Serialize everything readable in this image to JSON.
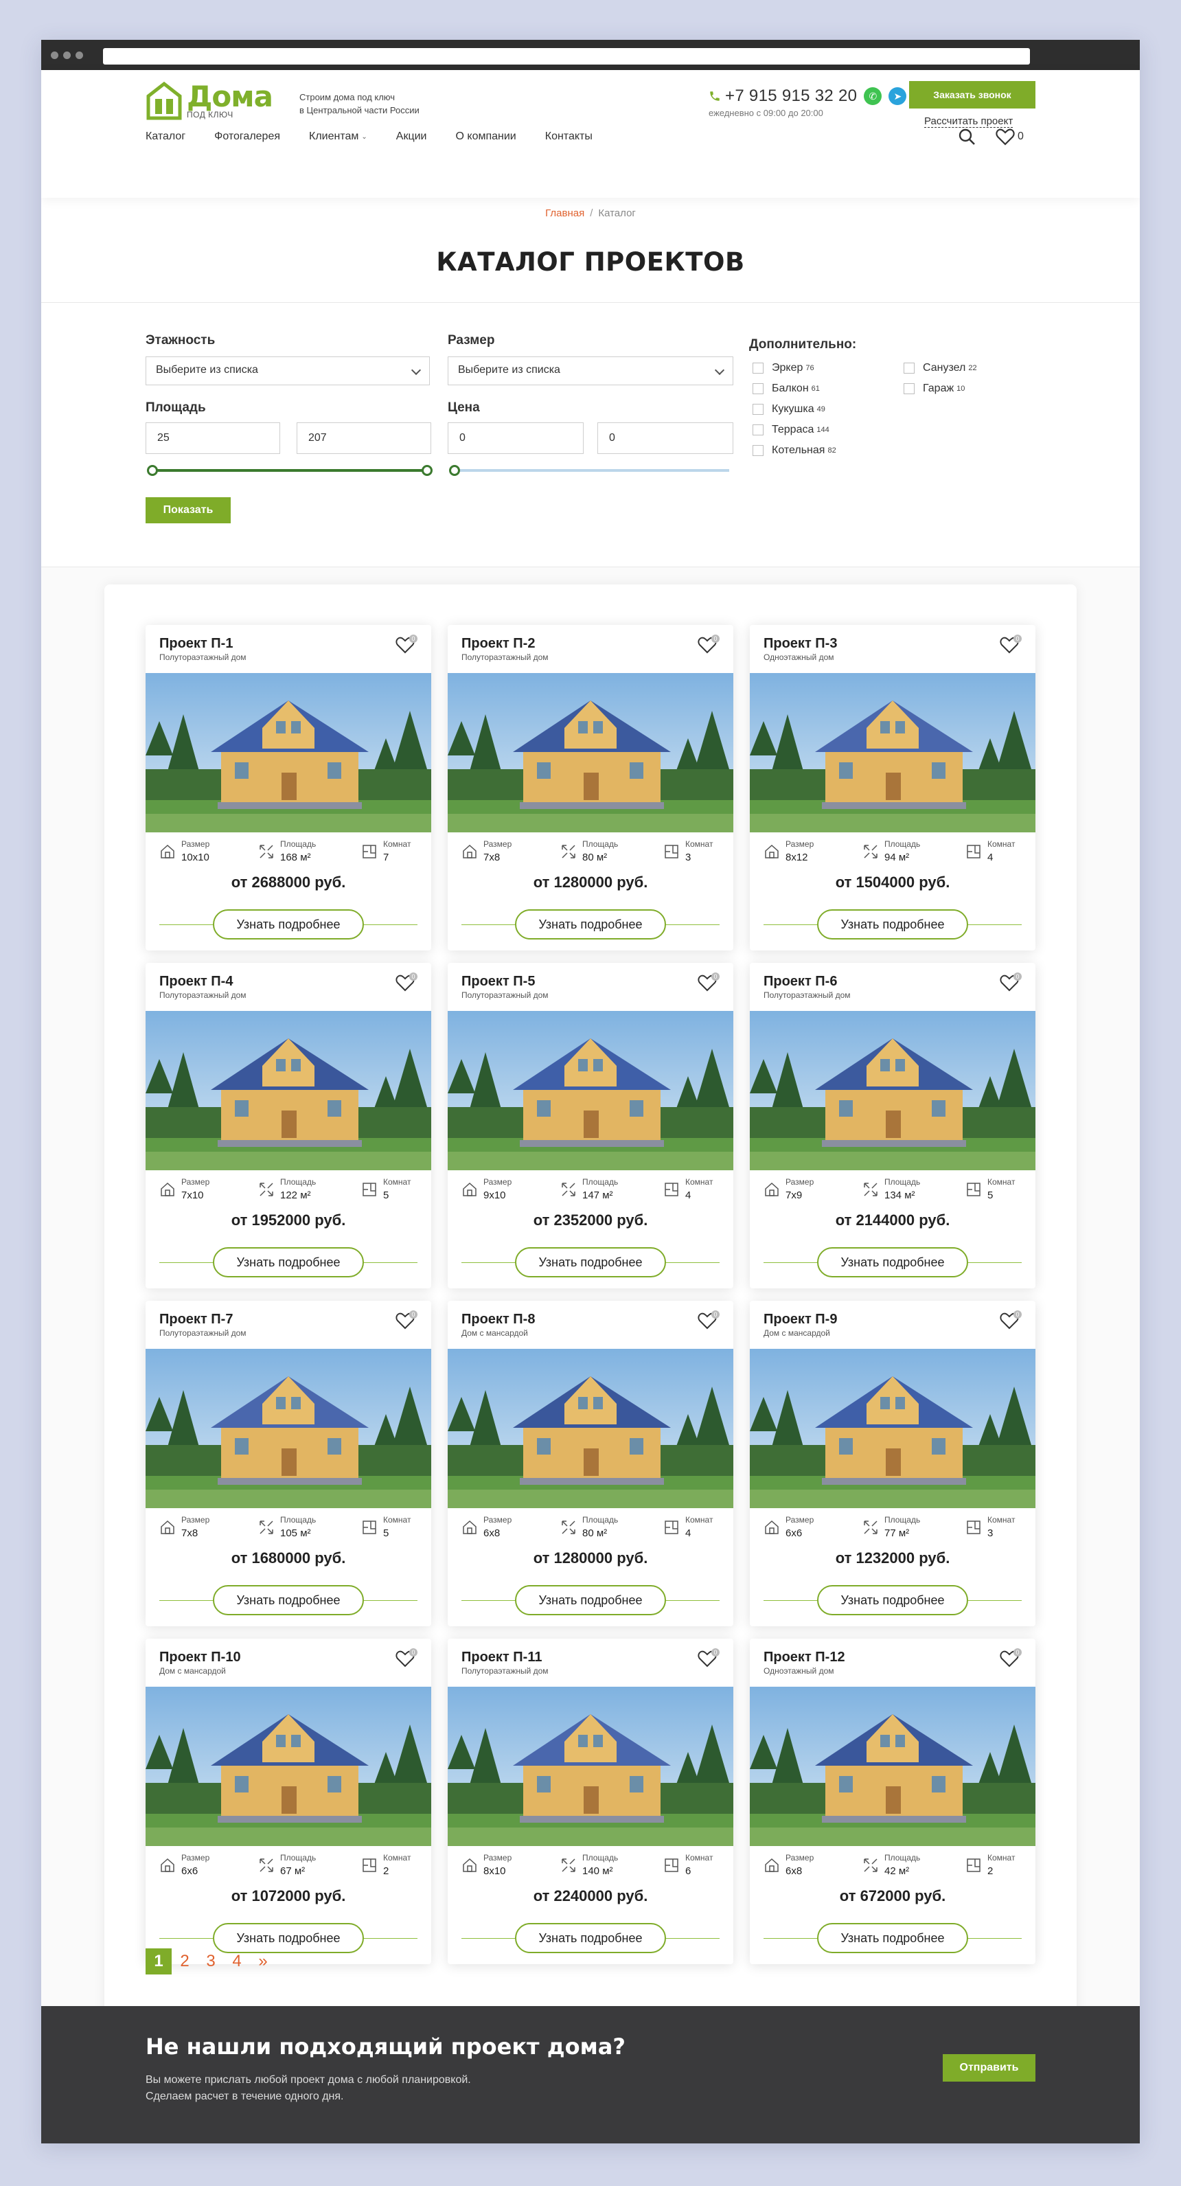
{
  "header": {
    "logo_name": "Дома",
    "logo_sub": "ПОД КЛЮЧ",
    "tagline_line1": "Строим дома под ключ",
    "tagline_line2": "в Центральной части России",
    "phone": "+7 915 915 32 20",
    "hours": "ежедневно с 09:00 до 20:00",
    "call_button": "Заказать звонок",
    "calc_link": "Рассчитать проект",
    "fav_count": "0",
    "nav": [
      {
        "label": "Каталог"
      },
      {
        "label": "Фотогалерея"
      },
      {
        "label": "Клиентам"
      },
      {
        "label": "Акции"
      },
      {
        "label": "О компании"
      },
      {
        "label": "Контакты"
      }
    ]
  },
  "breadcrumb": {
    "home": "Главная",
    "separator": "/",
    "current": "Каталог"
  },
  "page_title": "КАТАЛОГ ПРОЕКТОВ",
  "filter": {
    "floors_label": "Этажность",
    "floors_value": "Выберите из списка",
    "size_label": "Размер",
    "size_value": "Выберите из списка",
    "area_label": "Площадь",
    "area_min": "25",
    "area_max": "207",
    "price_label": "Цена",
    "price_min": "0",
    "price_max": "0",
    "area_slider_fraction": [
      0,
      1
    ],
    "price_slider_fraction": [
      0,
      0
    ],
    "extra_label": "Дополнительно:",
    "options": [
      {
        "label": "Эркер",
        "count": "76"
      },
      {
        "label": "Балкон",
        "count": "61"
      },
      {
        "label": "Кукушка",
        "count": "49"
      },
      {
        "label": "Терраса",
        "count": "144"
      },
      {
        "label": "Котельная",
        "count": "82"
      },
      {
        "label": "Санузел",
        "count": "22"
      },
      {
        "label": "Гараж",
        "count": "10"
      }
    ],
    "show_button": "Показать"
  },
  "card_labels": {
    "size": "Размер",
    "area": "Площадь",
    "rooms": "Комнат",
    "more": "Узнать подробнее",
    "fav_count": "0"
  },
  "projects": [
    {
      "title": "Проект П-1",
      "type": "Полутораэтажный дом",
      "size": "10х10",
      "area": "168 м²",
      "rooms": "7",
      "price": "от 2688000 руб."
    },
    {
      "title": "Проект П-2",
      "type": "Полутораэтажный дом",
      "size": "7х8",
      "area": "80 м²",
      "rooms": "3",
      "price": "от 1280000 руб."
    },
    {
      "title": "Проект П-3",
      "type": "Одноэтажный дом",
      "size": "8х12",
      "area": "94 м²",
      "rooms": "4",
      "price": "от 1504000 руб."
    },
    {
      "title": "Проект П-4",
      "type": "Полутораэтажный дом",
      "size": "7х10",
      "area": "122 м²",
      "rooms": "5",
      "price": "от 1952000 руб."
    },
    {
      "title": "Проект П-5",
      "type": "Полутораэтажный дом",
      "size": "9х10",
      "area": "147 м²",
      "rooms": "4",
      "price": "от 2352000 руб."
    },
    {
      "title": "Проект П-6",
      "type": "Полутораэтажный дом",
      "size": "7х9",
      "area": "134 м²",
      "rooms": "5",
      "price": "от 2144000 руб."
    },
    {
      "title": "Проект П-7",
      "type": "Полутораэтажный дом",
      "size": "7х8",
      "area": "105 м²",
      "rooms": "5",
      "price": "от 1680000 руб."
    },
    {
      "title": "Проект П-8",
      "type": "Дом с мансардой",
      "size": "6х8",
      "area": "80 м²",
      "rooms": "4",
      "price": "от 1280000 руб."
    },
    {
      "title": "Проект П-9",
      "type": "Дом с мансардой",
      "size": "6х6",
      "area": "77 м²",
      "rooms": "3",
      "price": "от 1232000 руб."
    },
    {
      "title": "Проект П-10",
      "type": "Дом с мансардой",
      "size": "6х6",
      "area": "67 м²",
      "rooms": "2",
      "price": "от 1072000 руб."
    },
    {
      "title": "Проект П-11",
      "type": "Полутораэтажный дом",
      "size": "8х10",
      "area": "140 м²",
      "rooms": "6",
      "price": "от 2240000 руб."
    },
    {
      "title": "Проект П-12",
      "type": "Одноэтажный дом",
      "size": "6х8",
      "area": "42 м²",
      "rooms": "2",
      "price": "от 672000 руб."
    }
  ],
  "pagination": {
    "pages": [
      "1",
      "2",
      "3",
      "4"
    ],
    "next": "»",
    "active": "1"
  },
  "cta": {
    "title": "Не нашли подходящий проект дома?",
    "text_line1": "Вы можете прислать любой проект дома с любой планировкой.",
    "text_line2": "Сделаем расчет в течение одного дня.",
    "button": "Отправить"
  },
  "colors": {
    "accent": "#7fac29",
    "link": "#e0622f",
    "dark": "#3a3a3c",
    "slider": "#3b7a2e"
  }
}
